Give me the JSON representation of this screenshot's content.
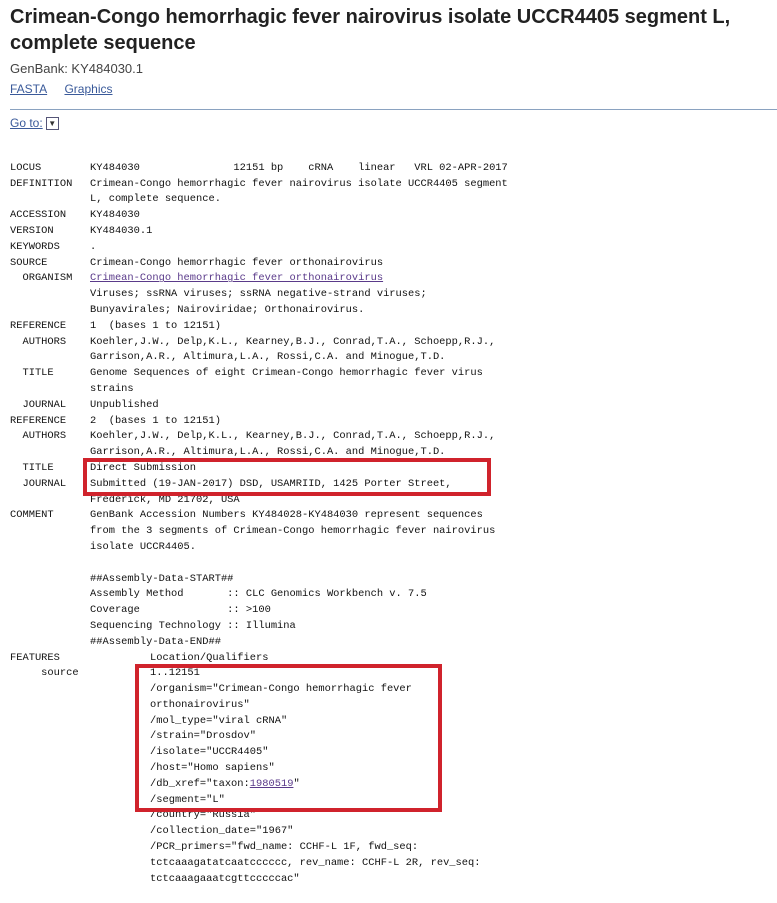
{
  "page": {
    "title_line1": "Crimean-Congo hemorrhagic fever nairovirus isolate UCCR4405 segment L,",
    "title_line2": "complete sequence",
    "accession_line": "GenBank: KY484030.1",
    "links": {
      "fasta": "FASTA",
      "graphics": "Graphics"
    },
    "goto_label": "Go to:"
  },
  "record": {
    "locus_key": "LOCUS",
    "locus": "KY484030               12151 bp    cRNA    linear   VRL 02-APR-2017",
    "definition_key": "DEFINITION",
    "definition1": "Crimean-Congo hemorrhagic fever nairovirus isolate UCCR4405 segment",
    "definition2": "L, complete sequence.",
    "accession_key": "ACCESSION",
    "accession": "KY484030",
    "version_key": "VERSION",
    "version": "KY484030.1",
    "keywords_key": "KEYWORDS",
    "keywords": ".",
    "source_key": "SOURCE",
    "source": "Crimean-Congo hemorrhagic fever orthonairovirus",
    "organism_key": "  ORGANISM",
    "organism_link": "Crimean-Congo hemorrhagic fever orthonairovirus",
    "taxonomy1": "Viruses; ssRNA viruses; ssRNA negative-strand viruses;",
    "taxonomy2": "Bunyavirales; Nairoviridae; Orthonairovirus.",
    "ref1_key": "REFERENCE",
    "ref1": "1  (bases 1 to 12151)",
    "ref1_authors_key": "  AUTHORS",
    "ref1_authors1": "Koehler,J.W., Delp,K.L., Kearney,B.J., Conrad,T.A., Schoepp,R.J.,",
    "ref1_authors2": "Garrison,A.R., Altimura,L.A., Rossi,C.A. and Minogue,T.D.",
    "ref1_title_key": "  TITLE",
    "ref1_title1": "Genome Sequences of eight Crimean-Congo hemorrhagic fever virus",
    "ref1_title2": "strains",
    "ref1_journal_key": "  JOURNAL",
    "ref1_journal": "Unpublished",
    "ref2_key": "REFERENCE",
    "ref2": "2  (bases 1 to 12151)",
    "ref2_authors_key": "  AUTHORS",
    "ref2_authors1": "Koehler,J.W., Delp,K.L., Kearney,B.J., Conrad,T.A., Schoepp,R.J.,",
    "ref2_authors2": "Garrison,A.R., Altimura,L.A., Rossi,C.A. and Minogue,T.D.",
    "ref2_title_key": "  TITLE",
    "ref2_title": "Direct Submission",
    "ref2_journal_key": "  JOURNAL",
    "ref2_journal1": "Submitted (19-JAN-2017) DSD, USAMRIID, 1425 Porter Street,",
    "ref2_journal2": "Frederick, MD 21702, USA",
    "comment_key": "COMMENT",
    "comment1": "GenBank Accession Numbers KY484028-KY484030 represent sequences",
    "comment2": "from the 3 segments of Crimean-Congo hemorrhagic fever nairovirus",
    "comment3": "isolate UCCR4405.",
    "assembly_start": "##Assembly-Data-START##",
    "assembly_method": "Assembly Method       :: CLC Genomics Workbench v. 7.5",
    "coverage": "Coverage              :: >100",
    "seq_tech": "Sequencing Technology :: Illumina",
    "assembly_end": "##Assembly-Data-END##",
    "features_key": "FEATURES",
    "features": "Location/Qualifiers",
    "source_feature_key": "     source",
    "source_feature": "1..12151",
    "q_organism1": "/organism=\"Crimean-Congo hemorrhagic fever",
    "q_organism2": "orthonairovirus\"",
    "q_mol_type": "/mol_type=\"viral cRNA\"",
    "q_strain": "/strain=\"Drosdov\"",
    "q_isolate": "/isolate=\"UCCR4405\"",
    "q_host": "/host=\"Homo sapiens\"",
    "q_db_xref_prefix": "/db_xref=\"taxon:",
    "q_db_xref_link": "1980519",
    "q_db_xref_suffix": "\"",
    "q_segment": "/segment=\"L\"",
    "q_country": "/country=\"Russia\"",
    "q_collection_date": "/collection_date=\"1967\"",
    "q_pcr1": "/PCR_primers=\"fwd_name: CCHF-L 1F, fwd_seq:",
    "q_pcr2": "tctcaaagatatcaatcccccc, rev_name: CCHF-L 2R, rev_seq:",
    "q_pcr3": "tctcaaagaaatcgttcccccac\""
  },
  "highlight_color": "#d0232c"
}
